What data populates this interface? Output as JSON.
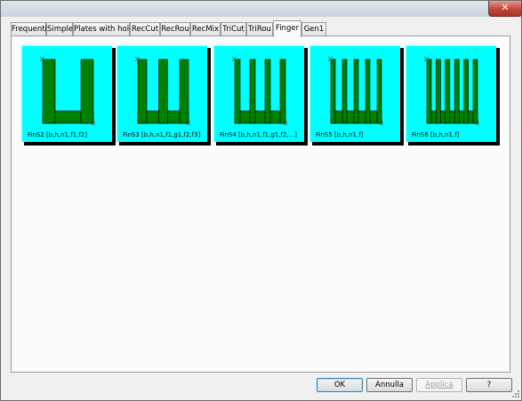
{
  "window": {
    "close_glyph": "✕"
  },
  "tabs": [
    {
      "label": "Frequenti",
      "active": false
    },
    {
      "label": "Simple",
      "active": false
    },
    {
      "label": "Plates with holes",
      "active": false
    },
    {
      "label": "RecCut",
      "active": false
    },
    {
      "label": "RecRou",
      "active": false
    },
    {
      "label": "RecMix",
      "active": false
    },
    {
      "label": "TriCut",
      "active": false
    },
    {
      "label": "TriRou",
      "active": false
    },
    {
      "label": "Finger",
      "active": true
    },
    {
      "label": "Gen1",
      "active": false
    }
  ],
  "shapes": [
    {
      "caption": "FinS2 [b,h,n1,f1,f2]",
      "fingers": 2
    },
    {
      "caption": "FinS3 [b,h,n1,f1,g1,f2,f3]",
      "fingers": 3
    },
    {
      "caption": "FinS4 [b,h,n1,f1,g1,f2,...]",
      "fingers": 4
    },
    {
      "caption": "FinS5 [b,h,n1,f]",
      "fingers": 5
    },
    {
      "caption": "FinS6 [b,h,n1,f]",
      "fingers": 6
    }
  ],
  "buttons": {
    "ok": "OK",
    "cancel": "Annulla",
    "apply": "Applica",
    "help": "?"
  },
  "colors": {
    "tile_background": "#00ffff",
    "shape_fill": "#007f00",
    "tile_shadow": "#000000"
  }
}
